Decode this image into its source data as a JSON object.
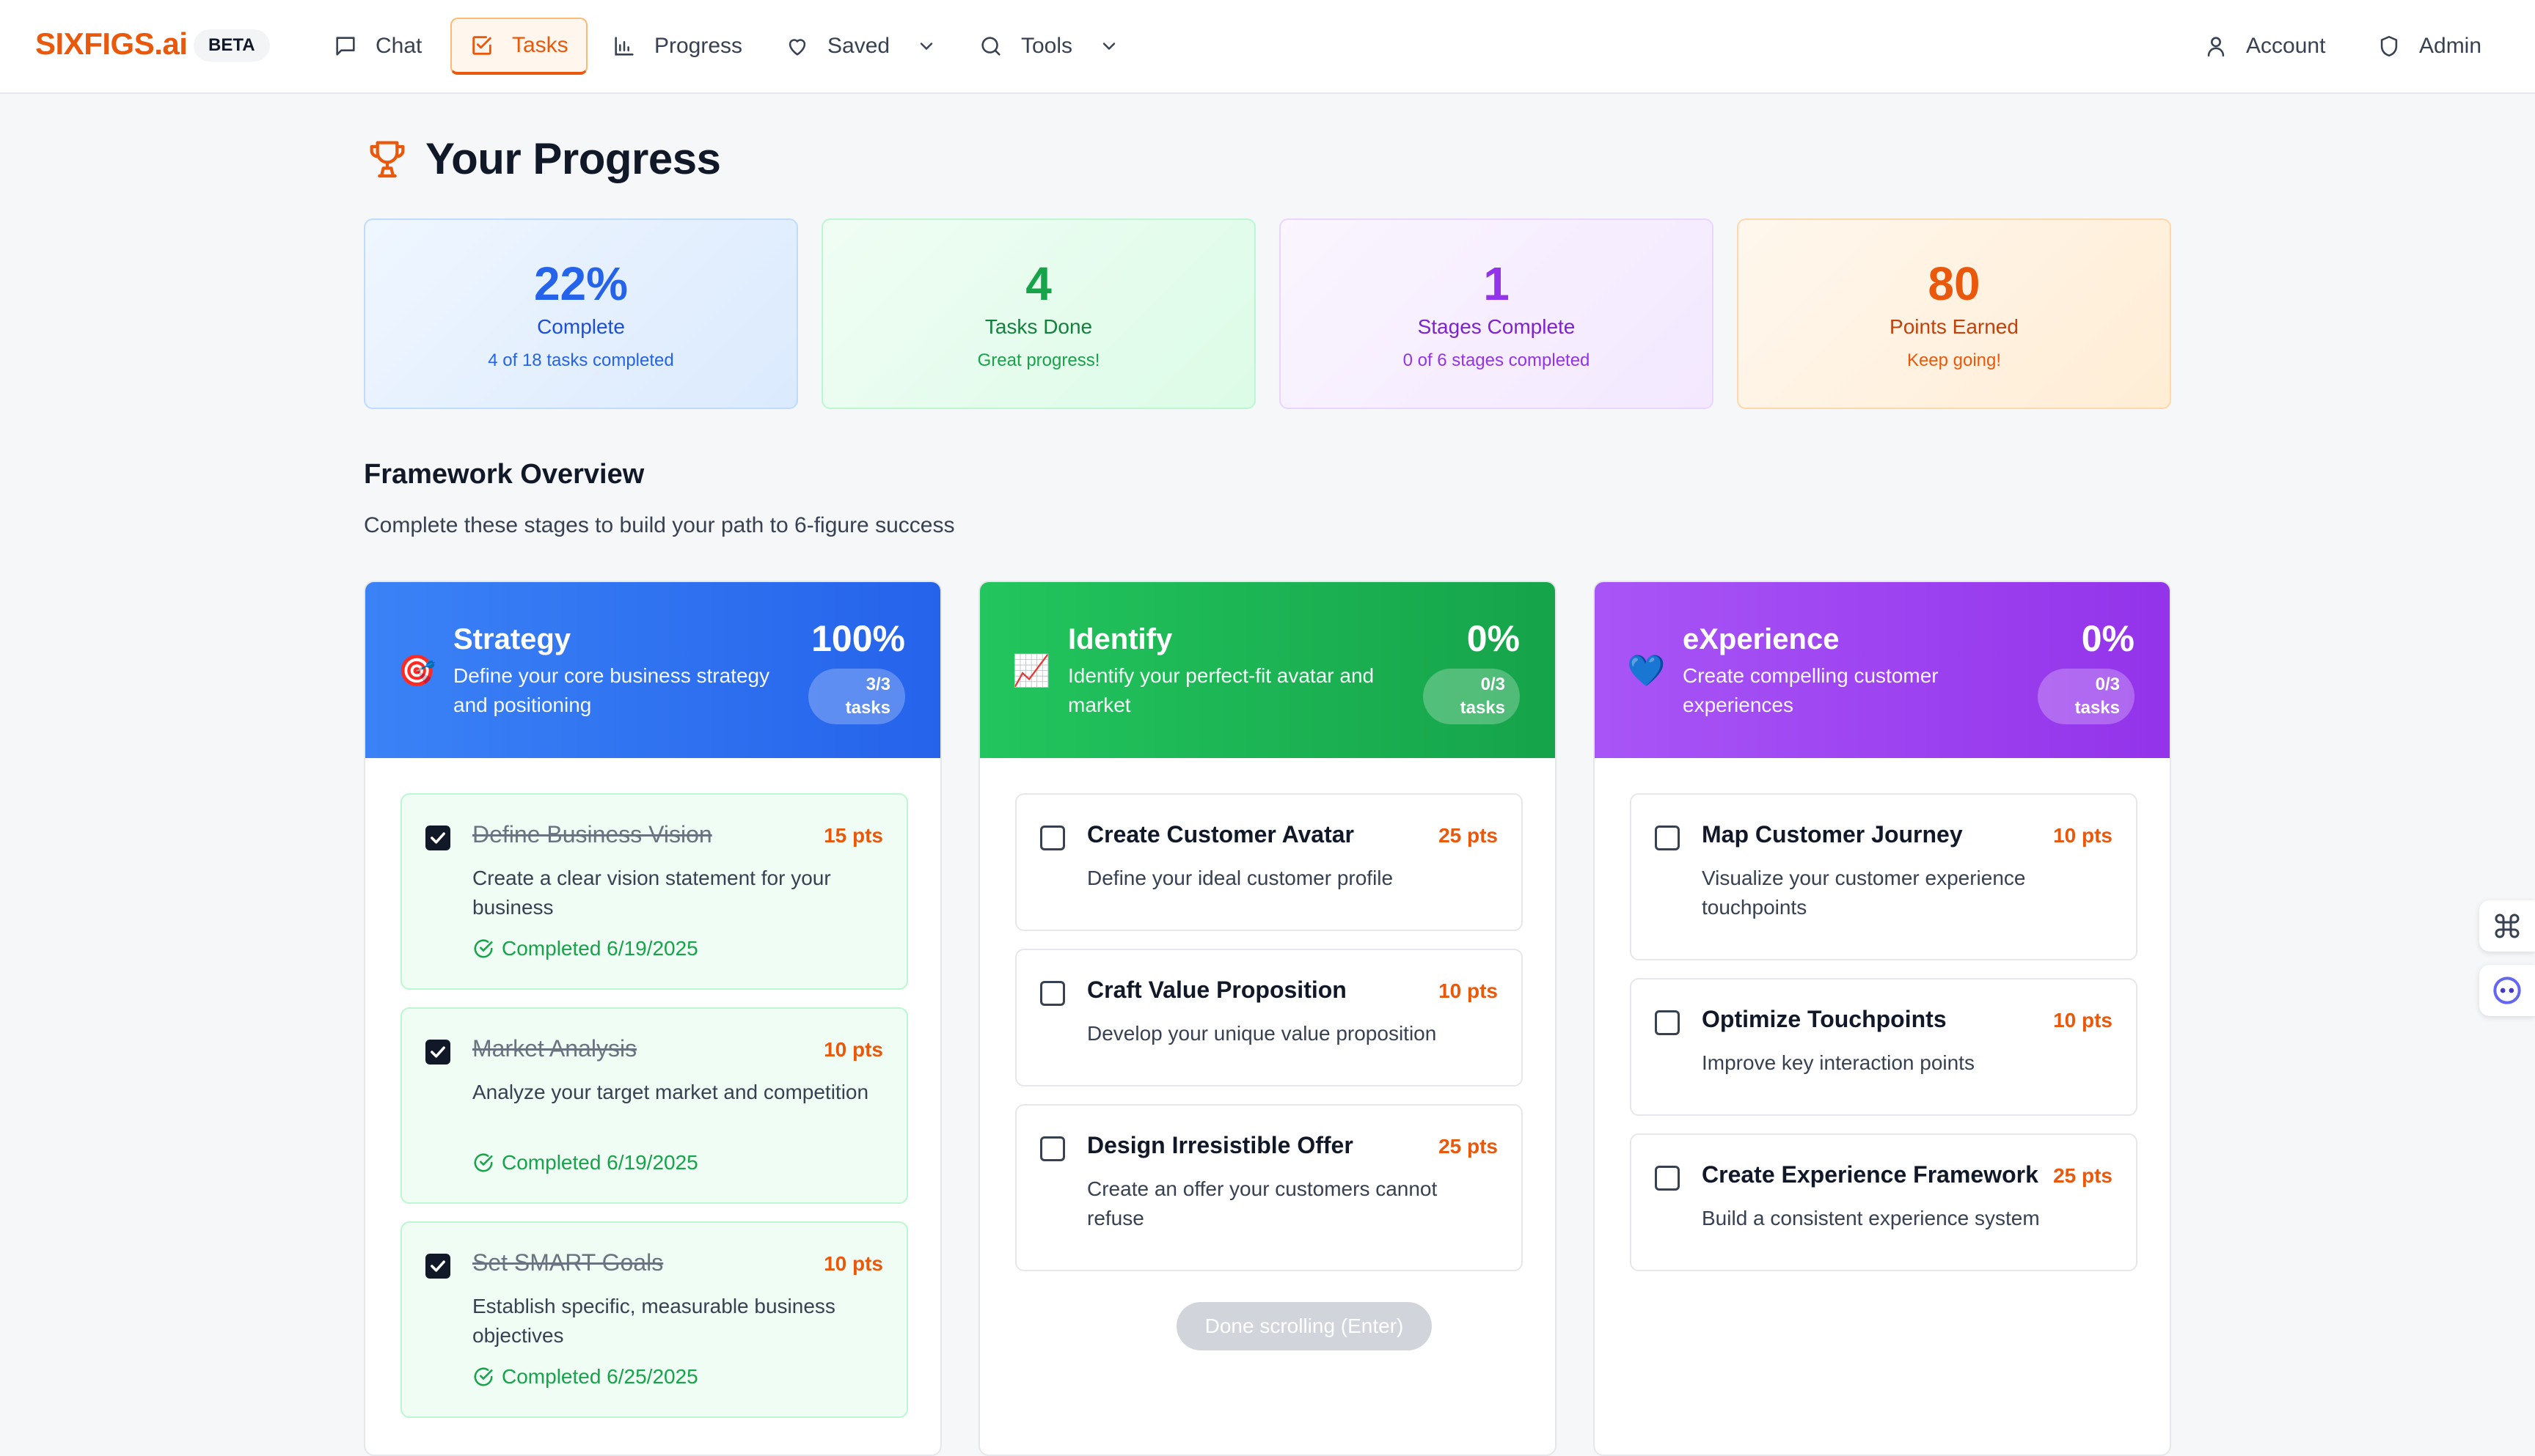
{
  "app": {
    "brand": "SIXFIGS.ai",
    "badge": "BETA"
  },
  "nav": {
    "items": [
      {
        "label": "Chat",
        "icon": "message-square-icon"
      },
      {
        "label": "Tasks",
        "icon": "check-square-icon",
        "active": true
      },
      {
        "label": "Progress",
        "icon": "bar-chart-icon"
      },
      {
        "label": "Saved",
        "icon": "heart-icon",
        "dropdown": true
      },
      {
        "label": "Tools",
        "icon": "search-icon",
        "dropdown": true
      }
    ],
    "right": [
      {
        "label": "Account",
        "icon": "user-icon"
      },
      {
        "label": "Admin",
        "icon": "shield-icon"
      }
    ]
  },
  "page": {
    "title": "Your Progress",
    "icon": "trophy-icon"
  },
  "stats": [
    {
      "value": "22%",
      "label": "Complete",
      "sub": "4 of 18 tasks completed",
      "color": "#2563eb"
    },
    {
      "value": "4",
      "label": "Tasks Done",
      "sub": "Great progress!",
      "color": "#16a34a"
    },
    {
      "value": "1",
      "label": "Stages Complete",
      "sub": "0 of 6 stages completed",
      "color": "#9333ea"
    },
    {
      "value": "80",
      "label": "Points Earned",
      "sub": "Keep going!",
      "color": "#ea580c"
    }
  ],
  "framework": {
    "title": "Framework Overview",
    "subtitle": "Complete these stages to build your path to 6-figure success",
    "stages": [
      {
        "emoji": "🎯",
        "name": "Strategy",
        "desc": "Define your core business strategy and positioning",
        "percent": "100%",
        "count": "3/3",
        "count_unit": "tasks",
        "color": "#3b82f6",
        "tasks": [
          {
            "title": "Define Business Vision",
            "points": "15 pts",
            "desc": "Create a clear vision statement for your business",
            "done": true,
            "completed": "Completed 6/19/2025"
          },
          {
            "title": "Market Analysis",
            "points": "10 pts",
            "desc": "Analyze your target market and competition",
            "done": true,
            "completed": "Completed 6/19/2025"
          },
          {
            "title": "Set SMART Goals",
            "points": "10 pts",
            "desc": "Establish specific, measurable business objectives",
            "done": true,
            "completed": "Completed 6/25/2025"
          }
        ]
      },
      {
        "emoji": "📈",
        "name": "Identify",
        "desc": "Identify your perfect-fit avatar and market",
        "percent": "0%",
        "count": "0/3",
        "count_unit": "tasks",
        "color": "#22c55e",
        "tasks": [
          {
            "title": "Create Customer Avatar",
            "points": "25 pts",
            "desc": "Define your ideal customer profile",
            "done": false
          },
          {
            "title": "Craft Value Proposition",
            "points": "10 pts",
            "desc": "Develop your unique value proposition",
            "done": false
          },
          {
            "title": "Design Irresistible Offer",
            "points": "25 pts",
            "desc": "Create an offer your customers cannot refuse",
            "done": false
          }
        ]
      },
      {
        "emoji": "💙",
        "name": "eXperience",
        "desc": "Create compelling customer experiences",
        "percent": "0%",
        "count": "0/3",
        "count_unit": "tasks",
        "color": "#a855f7",
        "tasks": [
          {
            "title": "Map Customer Journey",
            "points": "10 pts",
            "desc": "Visualize your customer experience touchpoints",
            "done": false
          },
          {
            "title": "Optimize Touchpoints",
            "points": "10 pts",
            "desc": "Improve key interaction points",
            "done": false
          },
          {
            "title": "Create Experience Framework",
            "points": "25 pts",
            "desc": "Build a consistent experience system",
            "done": false
          }
        ]
      }
    ]
  },
  "scroll_button": "Done scrolling (Enter)",
  "side_buttons": [
    {
      "icon": "command-icon"
    },
    {
      "icon": "assistant-face-icon"
    }
  ]
}
